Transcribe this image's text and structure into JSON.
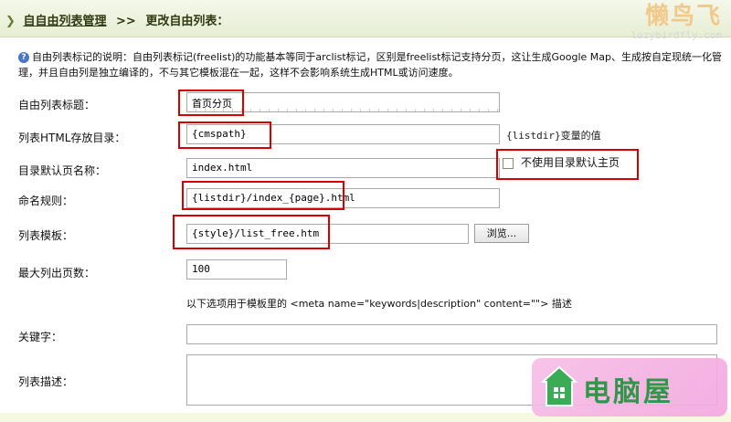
{
  "breadcrumb": {
    "parent": "自自由列表管理",
    "separator": ">>",
    "current": "更改自由列表："
  },
  "watermark_top": {
    "brand": "懒鸟飞",
    "url": "lazybirdfly.com"
  },
  "description": "自由列表标记的说明：自由列表标记(freelist)的功能基本等同于arclist标记，区别是freelist标记支持分页，这让生成Google Map、生成按自定现统一化管理，并且自由列是独立编译的，不与其它模板混在一起，这样不会影响系统生成HTML或访问速度。",
  "form": {
    "title_label": "自由列表标题：",
    "title_value": "首页分页",
    "dir_label": "列表HTML存放目录：",
    "dir_value": "{cmspath}",
    "dir_note": "{listdir}变量的值",
    "default_label": "目录默认页名称：",
    "default_value": "index.html",
    "no_default_label": "不使用目录默认主页",
    "naming_label": "命名规则：",
    "naming_value": "{listdir}/index_{page}.html",
    "template_label": "列表模板：",
    "template_value": "{style}/list_free.htm",
    "browse_label": "浏览...",
    "max_pages_label": "最大列出页数：",
    "max_pages_value": "100",
    "meta_hint": "以下选项用于模板里的 <meta name=\"keywords|description\" content=\"\"> 描述",
    "keywords_label": "关键字：",
    "keywords_value": "",
    "list_desc_label": "列表描述："
  },
  "watermark_bottom": {
    "brand": "电脑屋"
  },
  "colors": {
    "highlight": "#d60000",
    "header_bg": "#e6eed3",
    "watermark_pink": "#f3a8df",
    "watermark_green": "#1f8f3a"
  }
}
